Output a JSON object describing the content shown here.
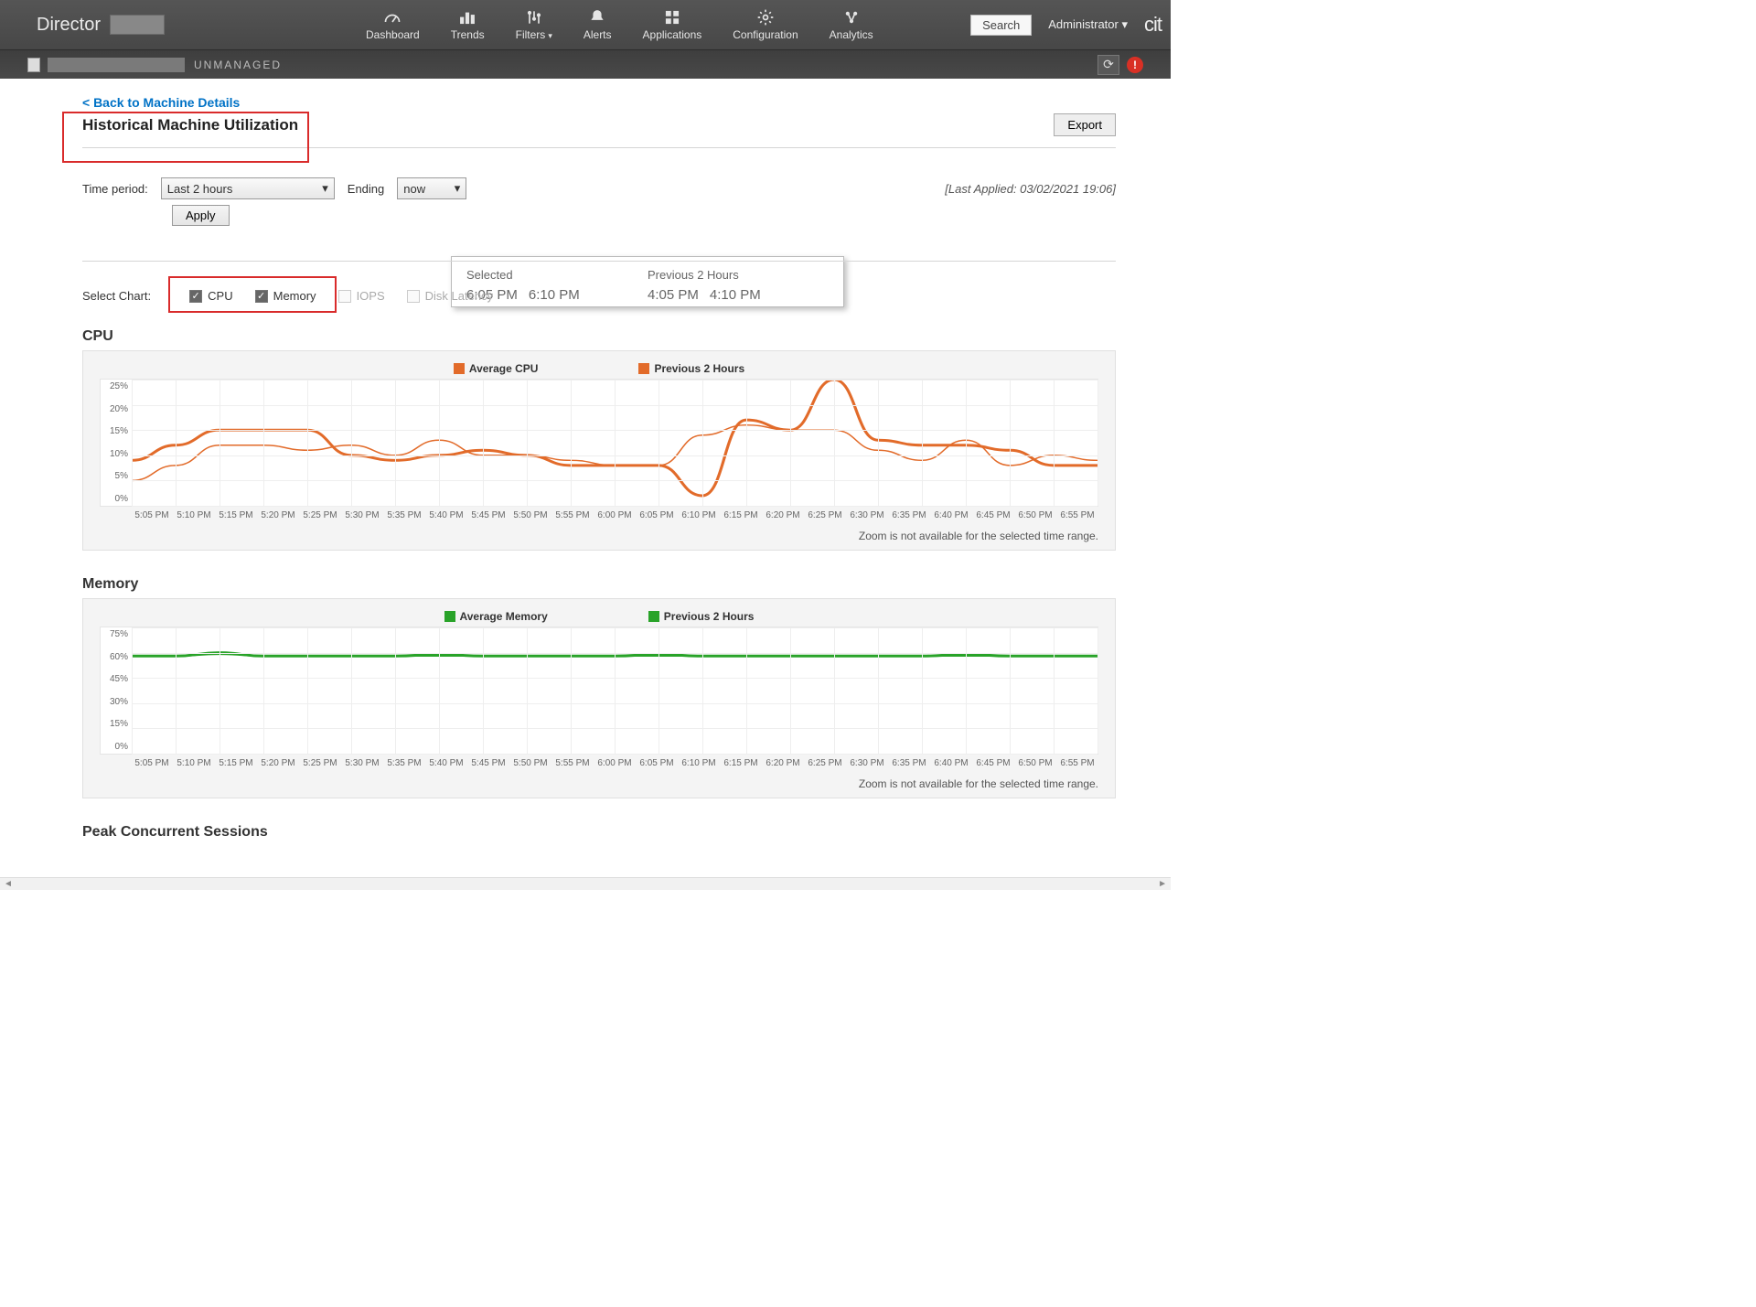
{
  "brand": "Director",
  "nav": {
    "dashboard": "Dashboard",
    "trends": "Trends",
    "filters": "Filters",
    "alerts": "Alerts",
    "applications": "Applications",
    "configuration": "Configuration",
    "analytics": "Analytics"
  },
  "search_label": "Search",
  "admin_label": "Administrator",
  "logo_cut": "cit",
  "subbar": {
    "status": "UNMANAGED",
    "alert_glyph": "!"
  },
  "back_link": "< Back to Machine Details",
  "page_title": "Historical Machine Utilization",
  "export_label": "Export",
  "filters": {
    "time_period_label": "Time period:",
    "time_period_value": "Last 2 hours",
    "ending_label": "Ending",
    "ending_value": "now",
    "apply_label": "Apply",
    "last_applied": "[Last Applied: 03/02/2021 19:06]"
  },
  "popup": {
    "selected_label": "Selected",
    "previous_label": "Previous 2 Hours",
    "sel_t1": "6:05 PM",
    "sel_t2": "6:10 PM",
    "prev_t1": "4:05 PM",
    "prev_t2": "4:10 PM"
  },
  "select_chart": {
    "label": "Select Chart:",
    "cpu": "CPU",
    "memory": "Memory",
    "iops": "IOPS",
    "disk_latency": "Disk Latency"
  },
  "zoom_note": "Zoom is not available for the selected time range.",
  "sessions_title": "Peak Concurrent Sessions",
  "chart_data": [
    {
      "type": "line",
      "title": "CPU",
      "ylabel": "%",
      "ylim": [
        0,
        25
      ],
      "yticks": [
        "25%",
        "20%",
        "15%",
        "10%",
        "5%",
        "0%"
      ],
      "color": "#e26b2a",
      "legend": [
        "Average CPU",
        "Previous 2 Hours"
      ],
      "categories": [
        "5:05 PM",
        "5:10 PM",
        "5:15 PM",
        "5:20 PM",
        "5:25 PM",
        "5:30 PM",
        "5:35 PM",
        "5:40 PM",
        "5:45 PM",
        "5:50 PM",
        "5:55 PM",
        "6:00 PM",
        "6:05 PM",
        "6:10 PM",
        "6:15 PM",
        "6:20 PM",
        "6:25 PM",
        "6:30 PM",
        "6:35 PM",
        "6:40 PM",
        "6:45 PM",
        "6:50 PM",
        "6:55 PM"
      ],
      "series": [
        {
          "name": "Average CPU",
          "values": [
            9,
            12,
            15,
            15,
            15,
            10,
            9,
            10,
            11,
            10,
            8,
            8,
            8,
            2,
            17,
            15,
            25,
            13,
            12,
            12,
            11,
            8,
            8
          ]
        },
        {
          "name": "Previous 2 Hours",
          "values": [
            5,
            8,
            12,
            12,
            11,
            12,
            10,
            13,
            10,
            10,
            9,
            8,
            8,
            14,
            16,
            15,
            15,
            11,
            9,
            13,
            8,
            10,
            9
          ]
        }
      ]
    },
    {
      "type": "line",
      "title": "Memory",
      "ylabel": "%",
      "ylim": [
        0,
        75
      ],
      "yticks": [
        "75%",
        "60%",
        "45%",
        "30%",
        "15%",
        "0%"
      ],
      "color": "#29a329",
      "legend": [
        "Average Memory",
        "Previous 2 Hours"
      ],
      "categories": [
        "5:05 PM",
        "5:10 PM",
        "5:15 PM",
        "5:20 PM",
        "5:25 PM",
        "5:30 PM",
        "5:35 PM",
        "5:40 PM",
        "5:45 PM",
        "5:50 PM",
        "5:55 PM",
        "6:00 PM",
        "6:05 PM",
        "6:10 PM",
        "6:15 PM",
        "6:20 PM",
        "6:25 PM",
        "6:30 PM",
        "6:35 PM",
        "6:40 PM",
        "6:45 PM",
        "6:50 PM",
        "6:55 PM"
      ],
      "series": [
        {
          "name": "Average Memory",
          "values": [
            58,
            58,
            60,
            58,
            58,
            58,
            58,
            59,
            58,
            58,
            58,
            58,
            59,
            58,
            58,
            58,
            58,
            58,
            58,
            59,
            58,
            58,
            58
          ]
        },
        {
          "name": "Previous 2 Hours",
          "values": [
            58,
            58,
            59,
            58,
            58,
            58,
            58,
            58,
            58,
            58,
            58,
            58,
            58,
            58,
            58,
            58,
            58,
            58,
            58,
            58,
            58,
            58,
            58
          ]
        }
      ]
    }
  ]
}
